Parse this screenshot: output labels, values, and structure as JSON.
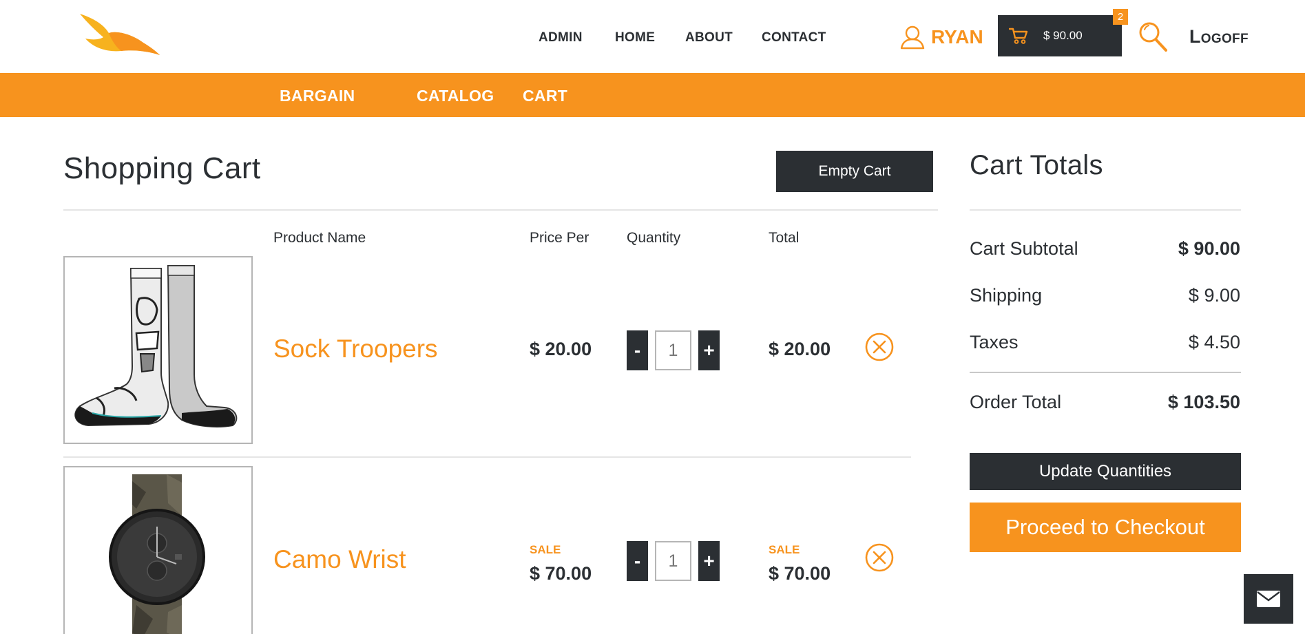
{
  "nav": {
    "top_items": [
      "ADMIN",
      "HOME",
      "ABOUT",
      "CONTACT"
    ],
    "user_name": "RYAN",
    "cart_amount": "$ 90.00",
    "cart_count": "2",
    "logoff_first": "L",
    "logoff_rest": "OGOFF"
  },
  "subnav": {
    "items": [
      "BARGAIN",
      "CATALOG",
      "CART"
    ]
  },
  "cart": {
    "title": "Shopping Cart",
    "empty_button": "Empty Cart",
    "columns": [
      "Product Name",
      "Price Per",
      "Quantity",
      "Total"
    ],
    "items": [
      {
        "name": "Sock Troopers",
        "price": "$ 20.00",
        "quantity": "1",
        "total": "$ 20.00",
        "sale_label": ""
      },
      {
        "name": "Camo Wrist",
        "price": "$ 70.00",
        "quantity": "1",
        "total": "$ 70.00",
        "sale_label": "SALE"
      }
    ],
    "minus_label": "-",
    "plus_label": "+"
  },
  "totals": {
    "title": "Cart Totals",
    "subtotal_label": "Cart Subtotal",
    "subtotal_value": "$ 90.00",
    "shipping_label": "Shipping",
    "shipping_value": "$ 9.00",
    "taxes_label": "Taxes",
    "taxes_value": "$ 4.50",
    "order_total_label": "Order Total",
    "order_total_value": "$ 103.50",
    "update_button": "Update Quantities",
    "checkout_button": "Proceed to Checkout"
  },
  "colors": {
    "accent": "#f7931e",
    "dark": "#2b2f33"
  },
  "icons": [
    "bird-logo-icon",
    "user-icon",
    "cart-icon",
    "search-icon",
    "remove-icon",
    "mail-icon"
  ]
}
